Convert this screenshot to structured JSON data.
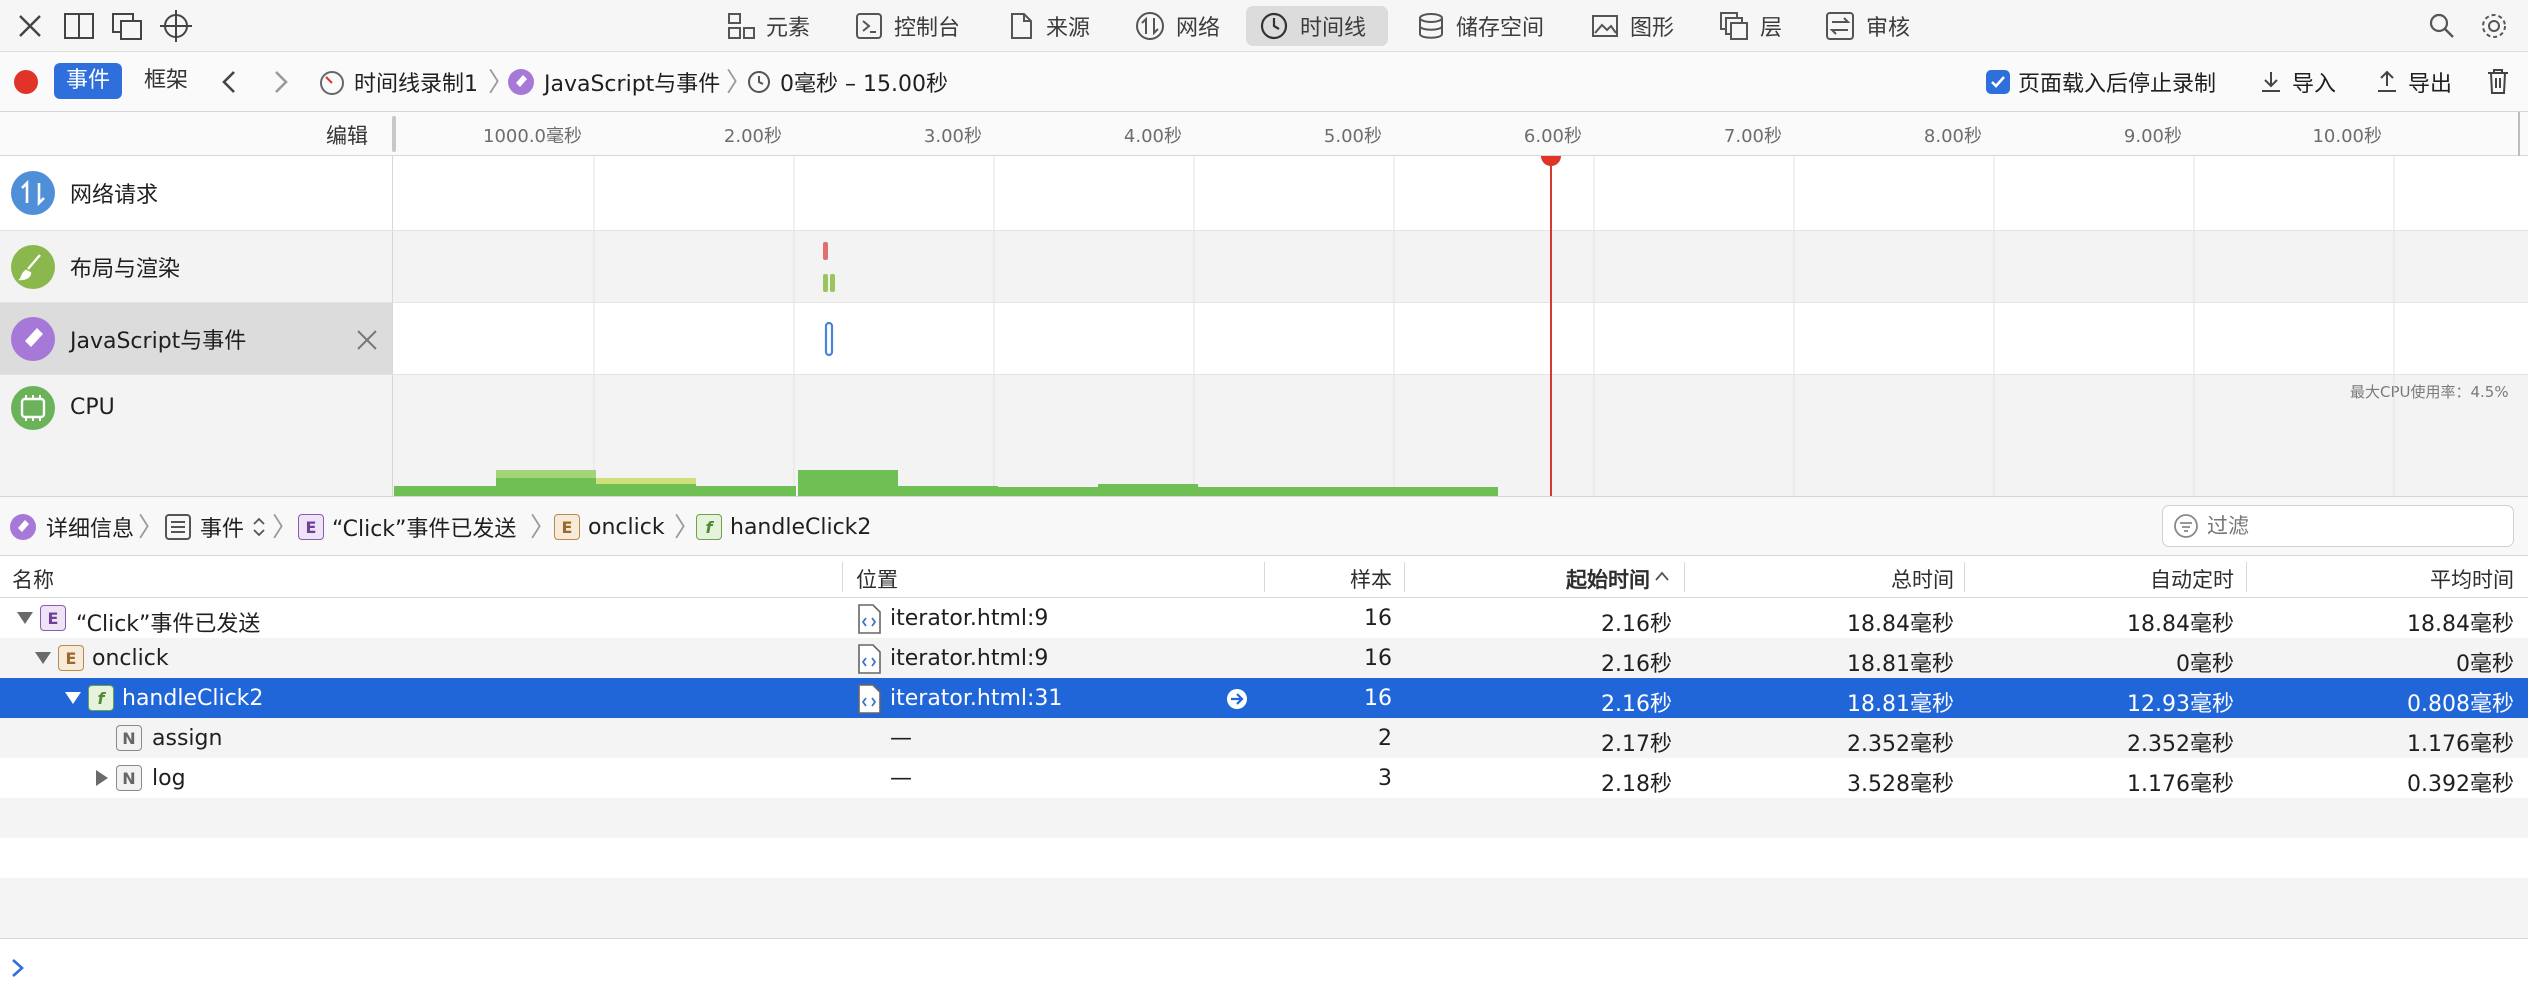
{
  "tabs": [
    {
      "label": "元素",
      "icon": "elements-icon"
    },
    {
      "label": "控制台",
      "icon": "console-icon"
    },
    {
      "label": "来源",
      "icon": "sources-icon"
    },
    {
      "label": "网络",
      "icon": "network-icon"
    },
    {
      "label": "时间线",
      "icon": "timeline-icon",
      "active": true
    },
    {
      "label": "储存空间",
      "icon": "storage-icon"
    },
    {
      "label": "图形",
      "icon": "graphics-icon"
    },
    {
      "label": "层",
      "icon": "layers-icon"
    },
    {
      "label": "审核",
      "icon": "audit-icon"
    }
  ],
  "toolbar": {
    "events_label": "事件",
    "frames_label": "框架",
    "recording": "时间线录制1",
    "js_events": "JavaScript与事件",
    "range": "0毫秒 – 15.00秒",
    "stop_after_load": "页面载入后停止录制",
    "import": "导入",
    "export": "导出"
  },
  "ruler": {
    "edit": "编辑",
    "ticks": [
      "1000.0毫秒",
      "2.00秒",
      "3.00秒",
      "4.00秒",
      "5.00秒",
      "6.00秒",
      "7.00秒",
      "8.00秒",
      "9.00秒",
      "10.00秒"
    ]
  },
  "tracks": {
    "network": "网络请求",
    "layout": "布局与渲染",
    "js": "JavaScript与事件",
    "cpu": "CPU",
    "cpu_max": "最大CPU使用率：4.5%"
  },
  "detail": {
    "crumbs": [
      "详细信息",
      "事件",
      "“Click”事件已发送",
      "onclick",
      "handleClick2"
    ],
    "filter_placeholder": "过滤"
  },
  "columns": {
    "name": "名称",
    "location": "位置",
    "samples": "样本",
    "start": "起始时间",
    "total": "总时间",
    "self": "自动定时",
    "avg": "平均时间"
  },
  "rows": [
    {
      "name": "“Click”事件已发送",
      "badge": "E",
      "location": "iterator.html:9",
      "samples": "16",
      "start": "2.16秒",
      "total": "18.84毫秒",
      "self": "18.84毫秒",
      "avg": "18.84毫秒"
    },
    {
      "name": "onclick",
      "badge": "E",
      "location": "iterator.html:9",
      "samples": "16",
      "start": "2.16秒",
      "total": "18.81毫秒",
      "self": "0毫秒",
      "avg": "0毫秒"
    },
    {
      "name": "handleClick2",
      "badge": "f",
      "location": "iterator.html:31",
      "samples": "16",
      "start": "2.16秒",
      "total": "18.81毫秒",
      "self": "12.93毫秒",
      "avg": "0.808毫秒"
    },
    {
      "name": "assign",
      "badge": "N",
      "location": "—",
      "samples": "2",
      "start": "2.17秒",
      "total": "2.352毫秒",
      "self": "2.352毫秒",
      "avg": "1.176毫秒"
    },
    {
      "name": "log",
      "badge": "N",
      "location": "—",
      "samples": "3",
      "start": "2.18秒",
      "total": "3.528毫秒",
      "self": "1.176毫秒",
      "avg": "0.392毫秒"
    }
  ],
  "colors": {
    "accent": "#2f6fdc",
    "record": "#e0342b",
    "selection": "#2166d8",
    "cpu_green": "#6fbf55"
  }
}
